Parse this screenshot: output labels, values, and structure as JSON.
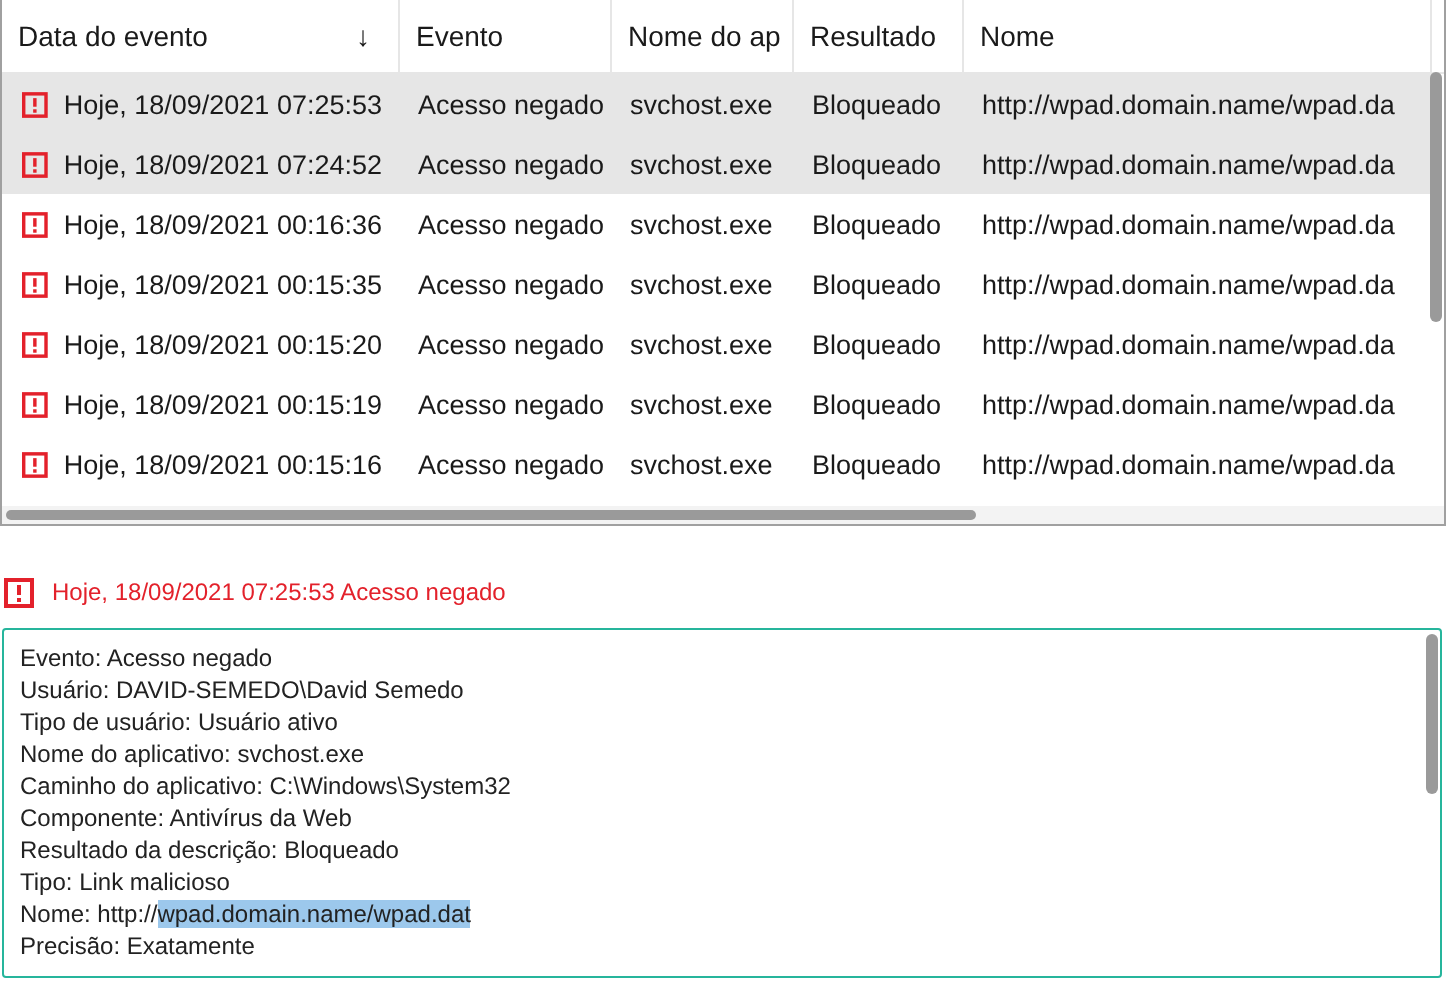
{
  "table": {
    "columns": [
      {
        "label": "Data do evento",
        "sort_arrow": "↓"
      },
      {
        "label": "Evento"
      },
      {
        "label": "Nome do ap"
      },
      {
        "label": "Resultado"
      },
      {
        "label": "Nome"
      }
    ],
    "rows": [
      {
        "selected": true,
        "cells": [
          "Hoje, 18/09/2021 07:25:53",
          "Acesso negado",
          "svchost.exe",
          "Bloqueado",
          "http://wpad.domain.name/wpad.da"
        ]
      },
      {
        "selected": true,
        "cells": [
          "Hoje, 18/09/2021 07:24:52",
          "Acesso negado",
          "svchost.exe",
          "Bloqueado",
          "http://wpad.domain.name/wpad.da"
        ]
      },
      {
        "selected": false,
        "cells": [
          "Hoje, 18/09/2021 00:16:36",
          "Acesso negado",
          "svchost.exe",
          "Bloqueado",
          "http://wpad.domain.name/wpad.da"
        ]
      },
      {
        "selected": false,
        "cells": [
          "Hoje, 18/09/2021 00:15:35",
          "Acesso negado",
          "svchost.exe",
          "Bloqueado",
          "http://wpad.domain.name/wpad.da"
        ]
      },
      {
        "selected": false,
        "cells": [
          "Hoje, 18/09/2021 00:15:20",
          "Acesso negado",
          "svchost.exe",
          "Bloqueado",
          "http://wpad.domain.name/wpad.da"
        ]
      },
      {
        "selected": false,
        "cells": [
          "Hoje, 18/09/2021 00:15:19",
          "Acesso negado",
          "svchost.exe",
          "Bloqueado",
          "http://wpad.domain.name/wpad.da"
        ]
      },
      {
        "selected": false,
        "cells": [
          "Hoje, 18/09/2021 00:15:16",
          "Acesso negado",
          "svchost.exe",
          "Bloqueado",
          "http://wpad.domain.name/wpad.da"
        ]
      }
    ]
  },
  "details": {
    "title": "Hoje, 18/09/2021 07:25:53 Acesso negado",
    "lines": [
      {
        "text": "Evento: Acesso negado"
      },
      {
        "text": "Usuário: DAVID-SEMEDO\\David Semedo"
      },
      {
        "text": "Tipo de usuário: Usuário ativo"
      },
      {
        "text": "Nome do aplicativo: svchost.exe"
      },
      {
        "text": "Caminho do aplicativo: C:\\Windows\\System32"
      },
      {
        "text": "Componente: Antivírus da Web"
      },
      {
        "text": "Resultado da descrição: Bloqueado"
      },
      {
        "text": "Tipo: Link malicioso"
      },
      {
        "text": "Nome: http://",
        "selection": "wpad.domain.name/wpad.dat"
      },
      {
        "text": "Precisão: Exatamente"
      }
    ]
  }
}
